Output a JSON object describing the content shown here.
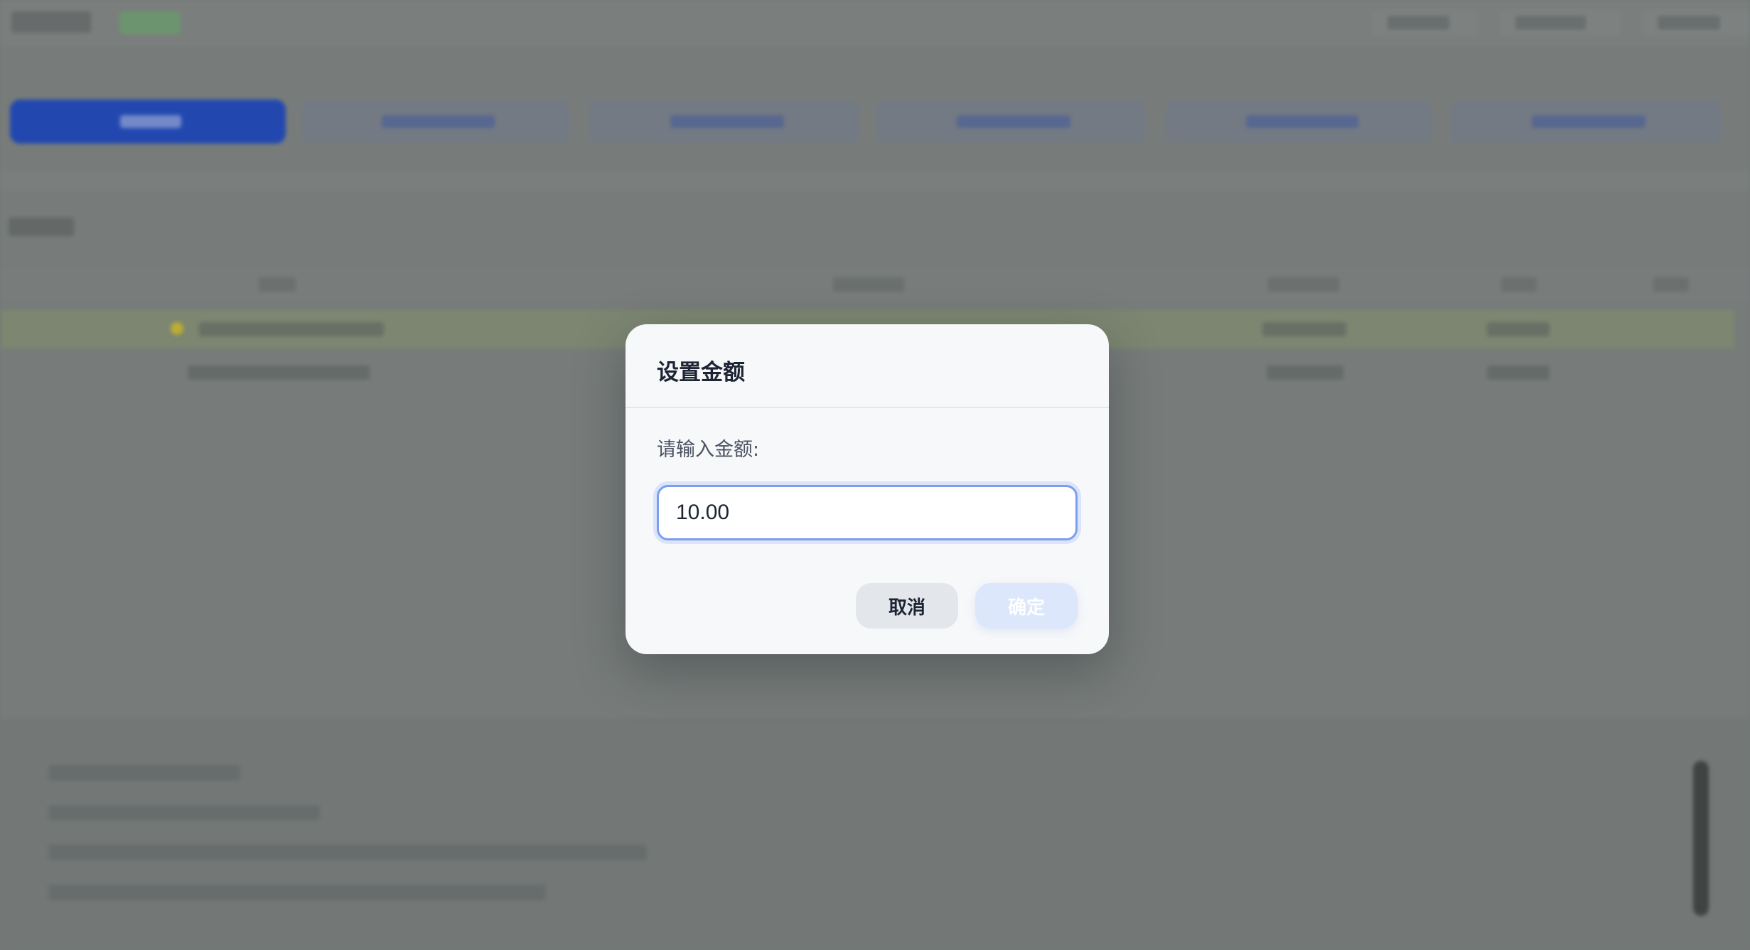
{
  "dialog": {
    "title": "设置金额",
    "prompt_label": "请输入金额:",
    "amount_value": "10.00",
    "cancel_label": "取消",
    "confirm_label": "确定"
  },
  "colors": {
    "active_tab": "#1f47b7",
    "input_border": "#7b9ef0",
    "confirm_button": "#dce7fb",
    "cancel_button": "#e3e6eb",
    "status_pill": "#6f9a70",
    "highlight_row": "#808a73",
    "star": "#c8b330"
  }
}
